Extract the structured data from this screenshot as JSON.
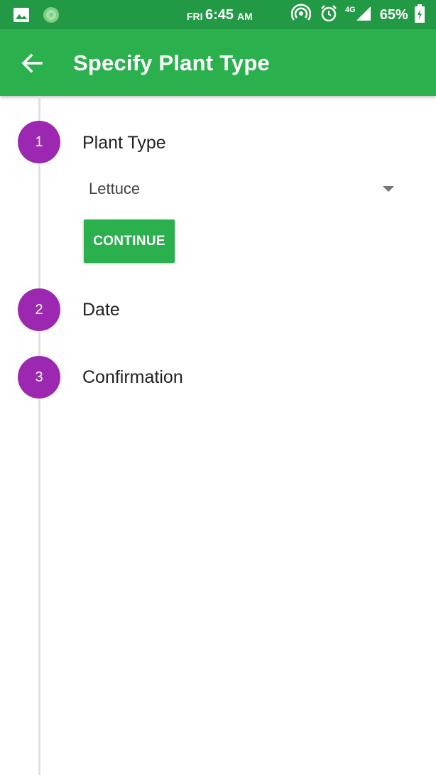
{
  "status_bar": {
    "day": "FRI",
    "time": "6:45",
    "ampm": "AM",
    "network": "4G",
    "battery": "65%",
    "icons": [
      "image-icon",
      "app-notification-icon",
      "hotspot-icon",
      "alarm-icon",
      "signal-icon",
      "battery-icon"
    ]
  },
  "app_bar": {
    "title": "Specify Plant Type",
    "back_icon": "back-arrow-icon",
    "color": "#2bb04e"
  },
  "stepper": {
    "accent_color": "#9c27b0",
    "steps": [
      {
        "number": "1",
        "title": "Plant Type"
      },
      {
        "number": "2",
        "title": "Date"
      },
      {
        "number": "3",
        "title": "Confirmation"
      }
    ],
    "plant_type_select": {
      "value": "Lettuce"
    },
    "continue_label": "CONTINUE"
  }
}
